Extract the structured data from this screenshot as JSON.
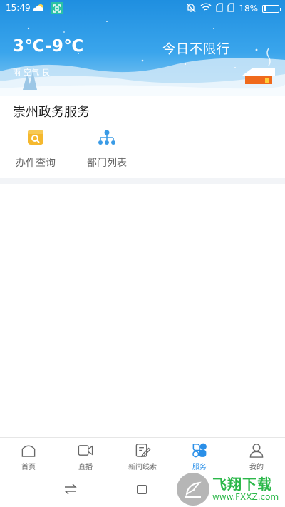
{
  "status_bar": {
    "time": "15:49",
    "battery": "18%",
    "icons": [
      "weather-cloud-icon",
      "scan-app-icon",
      "mute-bell-icon",
      "wifi-icon",
      "sim1-icon",
      "sim2-icon",
      "battery-icon"
    ]
  },
  "weather": {
    "temperature": "3℃-9℃",
    "traffic_restriction": "今日不限行",
    "condition": "雨",
    "air_label": "空气",
    "air_quality": "良"
  },
  "gov_service": {
    "title": "崇州政务服务",
    "items": [
      {
        "label": "办件查询",
        "icon": "search-folder-icon",
        "color": "#f5b82e"
      },
      {
        "label": "部门列表",
        "icon": "org-chart-icon",
        "color": "#3a9be6"
      }
    ]
  },
  "tabbar": {
    "active_color": "#2a8fe8",
    "tabs": [
      {
        "label": "首页",
        "icon": "home-icon",
        "active": false
      },
      {
        "label": "直播",
        "icon": "video-camera-icon",
        "active": false
      },
      {
        "label": "新闻线索",
        "icon": "edit-note-icon",
        "active": false
      },
      {
        "label": "服务",
        "icon": "services-grid-icon",
        "active": true
      },
      {
        "label": "我的",
        "icon": "user-icon",
        "active": false
      }
    ]
  },
  "system_nav": {
    "icons": [
      "switch-apps-icon",
      "home-square-icon"
    ]
  },
  "watermark": {
    "brand": "飞翔下载",
    "url": "www.FXXZ.com"
  }
}
